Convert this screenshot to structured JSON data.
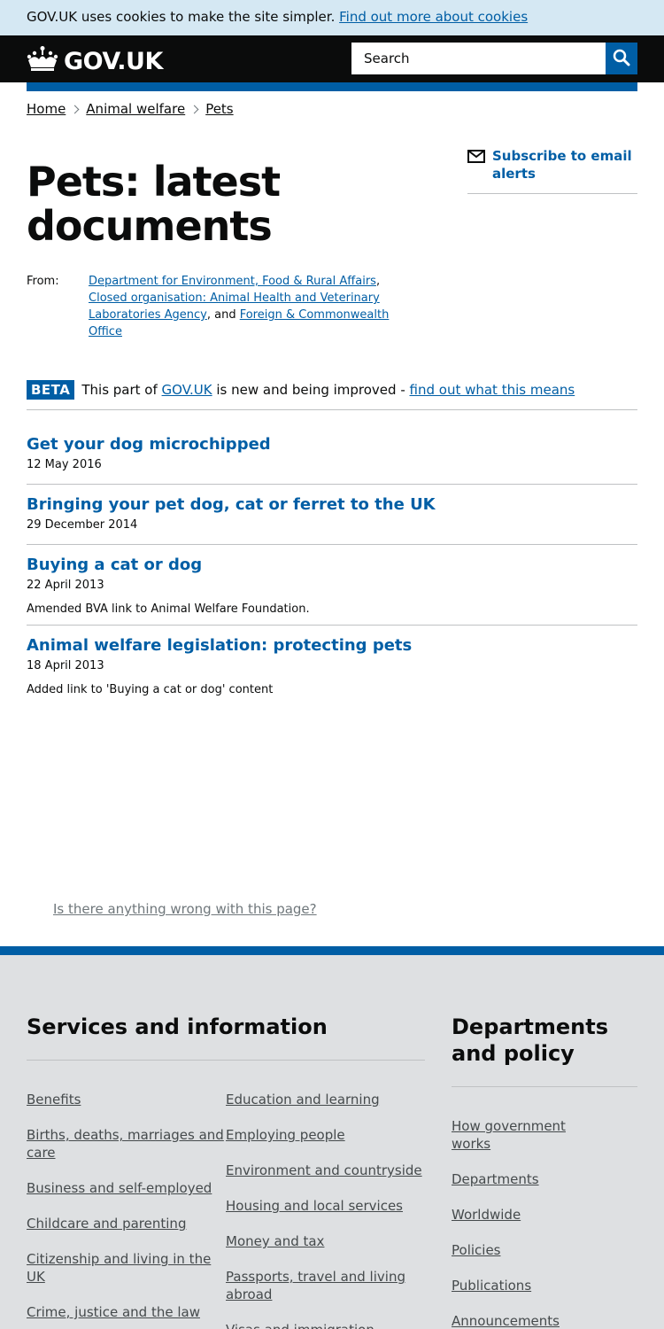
{
  "cookie_bar": {
    "text": "GOV.UK uses cookies to make the site simpler.",
    "link": "Find out more about cookies"
  },
  "header": {
    "logo_text": "GOV.UK",
    "search_placeholder": "Search"
  },
  "breadcrumb": [
    "Home",
    "Animal welfare",
    "Pets"
  ],
  "page": {
    "title": "Pets: latest documents",
    "from_label": "From:",
    "orgs": [
      "Department for Environment, Food & Rural Affairs",
      "Closed organisation: Animal Health and Veterinary Laboratories Agency",
      "Foreign & Commonwealth Office"
    ],
    "sep_comma": ", ",
    "sep_and": ", and "
  },
  "subscribe": {
    "label": "Subscribe to email alerts"
  },
  "beta": {
    "tag": "BETA",
    "text_before": "This part of ",
    "site_link": "GOV.UK",
    "text_after": " is new and being improved - ",
    "link": "find out what this means"
  },
  "documents": [
    {
      "title": "Get your dog microchipped",
      "date": "12 May 2016",
      "summary": ""
    },
    {
      "title": "Bringing your pet dog, cat or ferret to the UK",
      "date": "29 December 2014",
      "summary": ""
    },
    {
      "title": "Buying a cat or dog",
      "date": "22 April 2013",
      "summary": "Amended BVA link to Animal Welfare Foundation."
    },
    {
      "title": "Animal welfare legislation: protecting pets",
      "date": "18 April 2013",
      "summary": "Added link to 'Buying a cat or dog' content"
    }
  ],
  "report_link": "Is there anything wrong with this page?",
  "footer": {
    "services_heading": "Services and information",
    "services_col1": [
      "Benefits",
      "Births, deaths, marriages and care",
      "Business and self-employed",
      "Childcare and parenting",
      "Citizenship and living in the UK",
      "Crime, justice and the law"
    ],
    "services_col2": [
      "Education and learning",
      "Employing people",
      "Environment and countryside",
      "Housing and local services",
      "Money and tax",
      "Passports, travel and living abroad",
      "Visas and immigration"
    ],
    "depts_heading": "Departments and policy",
    "depts": [
      "How government works",
      "Departments",
      "Worldwide",
      "Policies",
      "Publications",
      "Announcements"
    ]
  },
  "colors": {
    "link_blue": "#005ea5",
    "header_black": "#0b0c0c",
    "cookie_bg": "#d5e8f3",
    "footer_bg": "#dee0e2"
  }
}
